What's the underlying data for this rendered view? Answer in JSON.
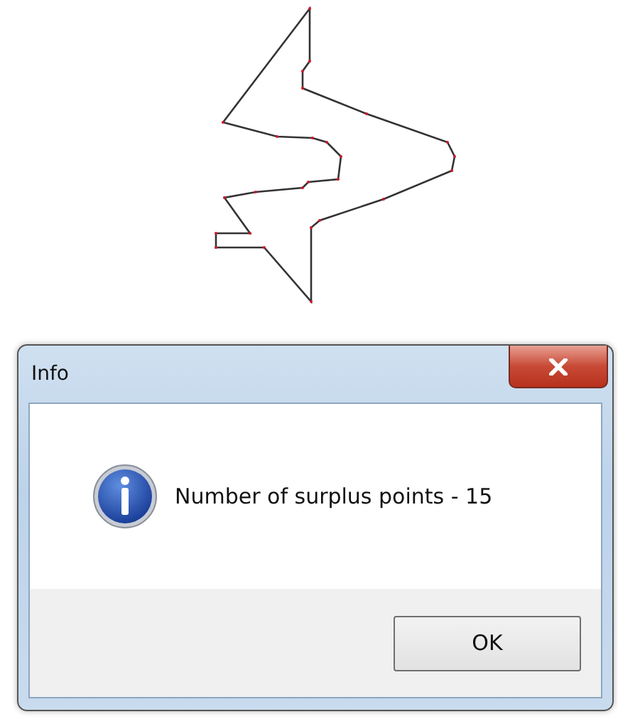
{
  "window": {
    "title": "Info"
  },
  "message": "Number of surplus points - 15",
  "buttons": [
    "OK"
  ]
}
